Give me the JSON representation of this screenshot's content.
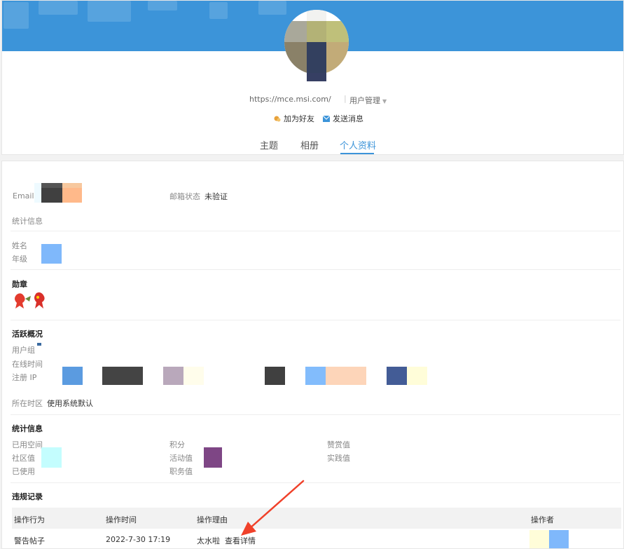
{
  "profile": {
    "url": "https://mce.msi.com/",
    "separator": "|",
    "user_management": "用户管理",
    "add_friend": "加为好友",
    "send_message": "发送消息"
  },
  "tabs": [
    {
      "label": "主题"
    },
    {
      "label": "相册"
    },
    {
      "label": "个人资料",
      "active": true
    }
  ],
  "info": {
    "email_label": "Email",
    "email_status_label": "邮箱状态",
    "email_status_value": "未验证",
    "stats_label": "统计信息",
    "name_label": "姓名",
    "grade_label": "年级"
  },
  "medals": {
    "title": "勋章"
  },
  "activity": {
    "title": "活跃概况",
    "user_group": "用户组",
    "online_time": "在线时间",
    "register_ip": "注册 IP",
    "timezone_label": "所在时区",
    "timezone_value": "使用系统默认"
  },
  "statistics": {
    "title": "统计信息",
    "used_space": "已用空间",
    "community_value": "社区值",
    "used": "已使用",
    "points": "积分",
    "activity_value": "活动值",
    "duty_value": "职务值",
    "appreciation_value": "赞赏值",
    "practice_value": "实践值"
  },
  "violations": {
    "title": "违规记录",
    "headers": {
      "action": "操作行为",
      "time": "操作时间",
      "reason": "操作理由",
      "operator": "操作者"
    },
    "rows": [
      {
        "action": "警告帖子",
        "time": "2022-7-30 17:19",
        "reason": "太水啦",
        "details": "查看详情"
      }
    ]
  },
  "colors": {
    "accent": "#3c94d9",
    "annotation_arrow": "#f0412a"
  }
}
